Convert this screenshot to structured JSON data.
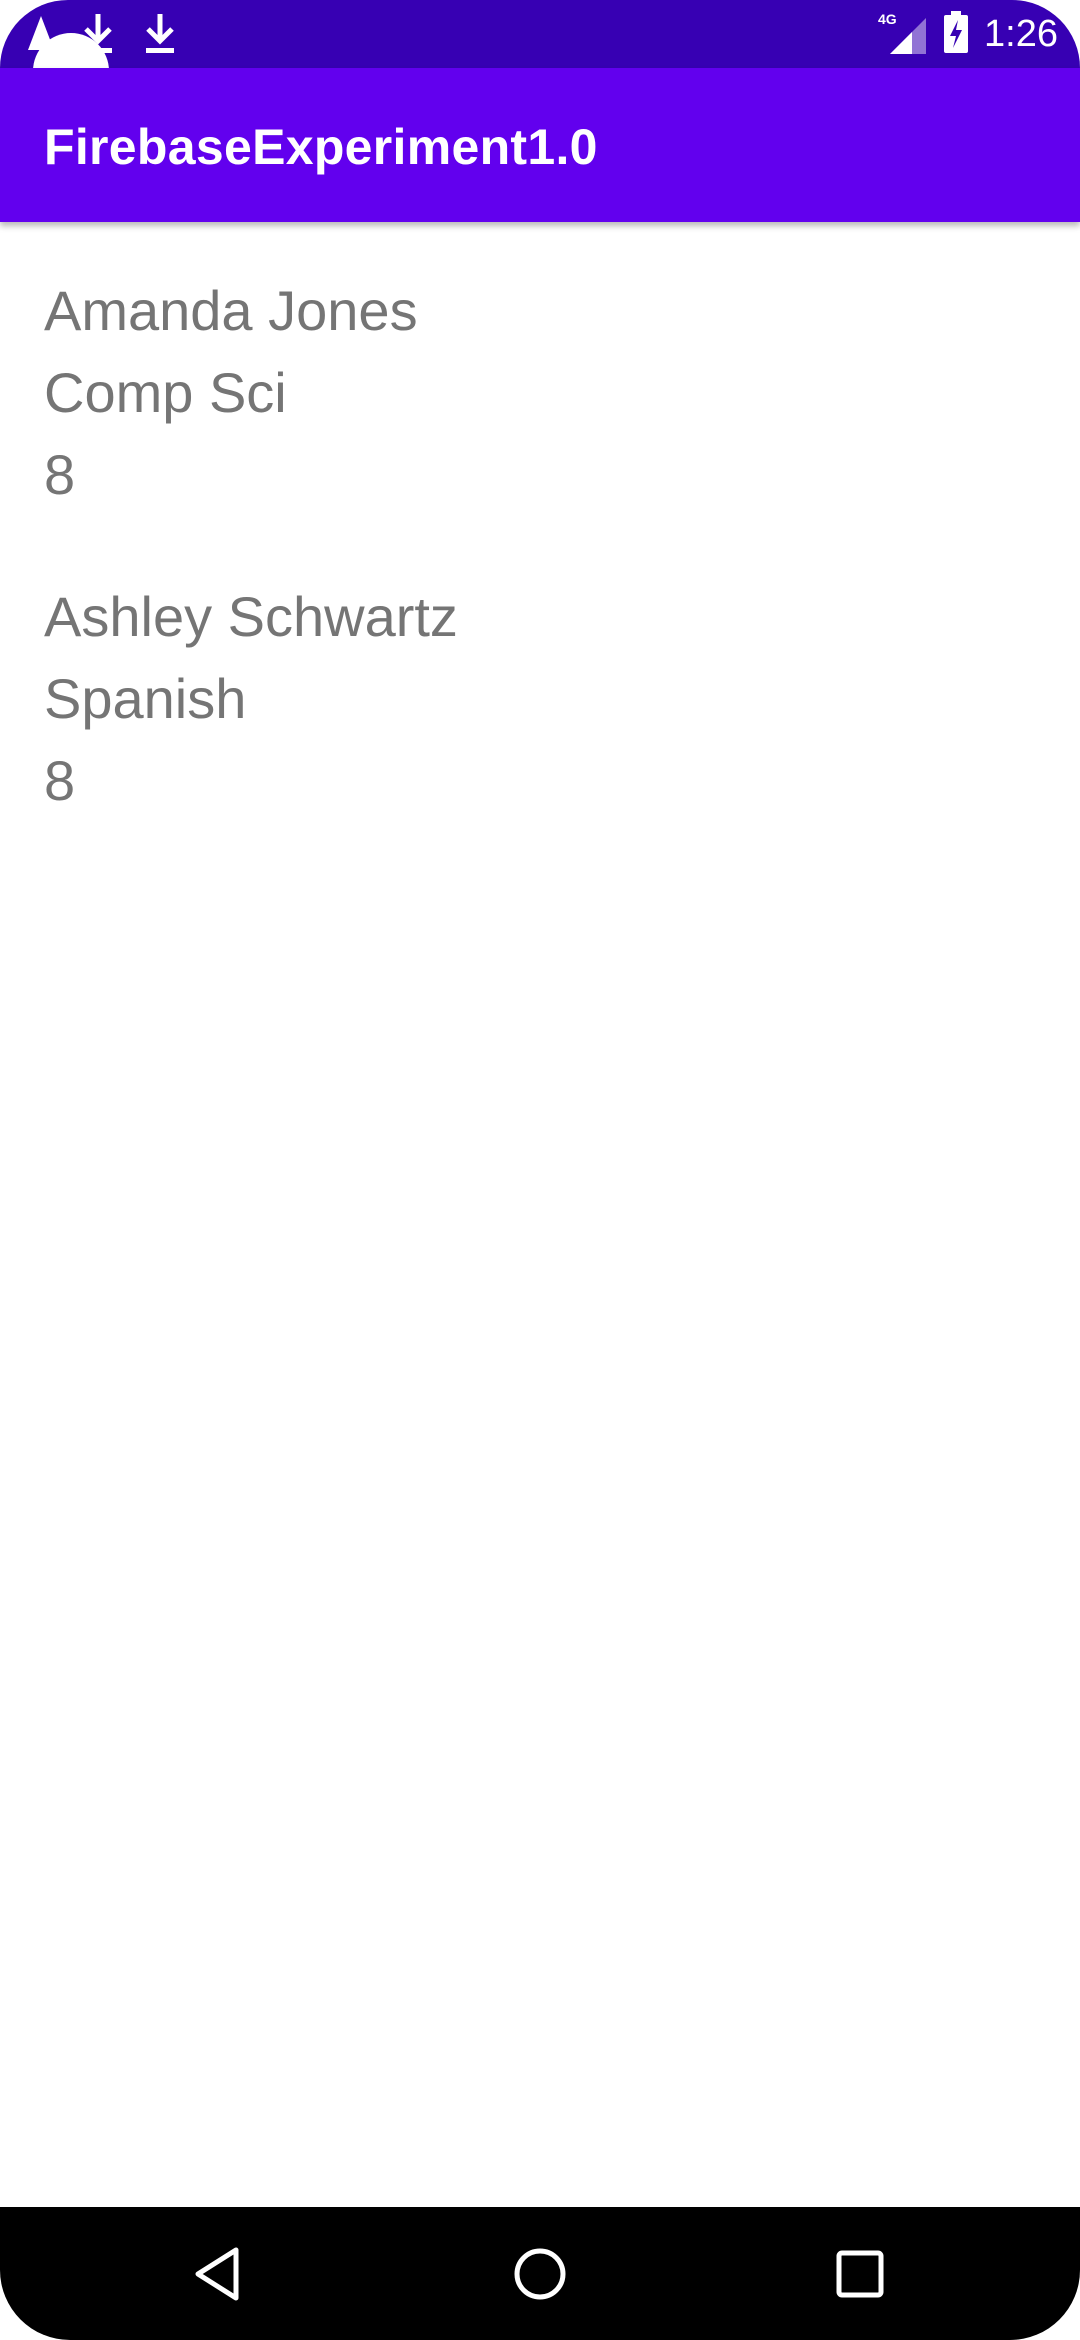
{
  "status_bar": {
    "time": "1:26",
    "network": "4G",
    "icons": [
      "android-alert-icon",
      "download-icon",
      "download-icon",
      "signal-icon",
      "battery-charging-icon"
    ]
  },
  "app_bar": {
    "title": "FirebaseExperiment1.0",
    "background": "#6200EE"
  },
  "students": [
    {
      "name": "Amanda Jones",
      "subject": "Comp Sci",
      "grade": "8"
    },
    {
      "name": "Ashley Schwartz",
      "subject": "Spanish",
      "grade": "8"
    }
  ],
  "nav_bar": {
    "buttons": [
      "back-icon",
      "home-icon",
      "recents-icon"
    ]
  },
  "colors": {
    "status_bar": "#3700B3",
    "app_bar": "#6200EE",
    "text": "#757575"
  }
}
